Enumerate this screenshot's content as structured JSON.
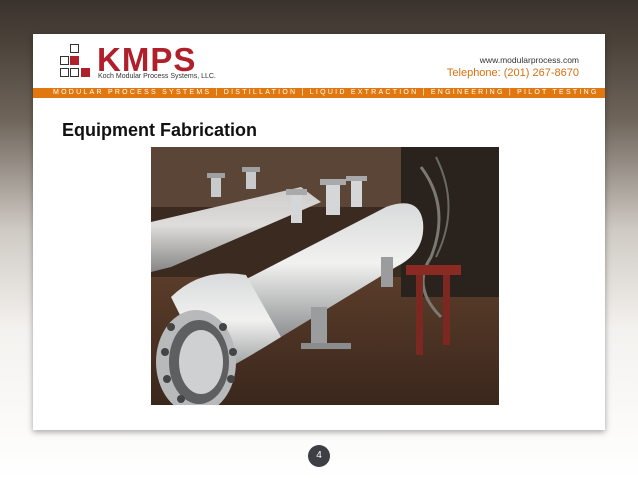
{
  "header": {
    "logo_word": "KMPS",
    "logo_subtitle": "Koch Modular Process Systems, LLC.",
    "website": "www.modularprocess.com",
    "telephone": "Telephone: (201) 267-8670"
  },
  "band": {
    "text": "MODULAR PROCESS SYSTEMS | DISTILLATION | LIQUID EXTRACTION | ENGINEERING | PILOT TESTING"
  },
  "slide": {
    "title": "Equipment Fabrication",
    "page_number": "4"
  },
  "colors": {
    "brand_red": "#b0202b",
    "band_orange": "#e0780f",
    "phone_orange": "#d86f12"
  }
}
